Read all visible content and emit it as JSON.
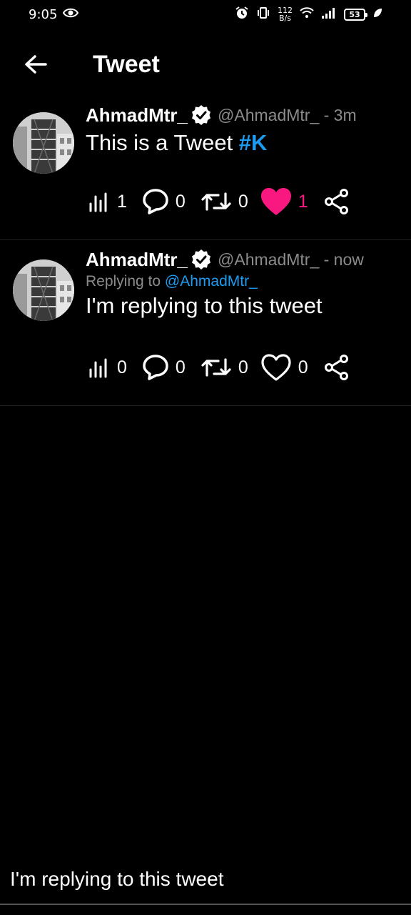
{
  "status_bar": {
    "time": "9:05",
    "net_speed_value": "112",
    "net_speed_unit": "B/s",
    "battery": "53"
  },
  "app_bar": {
    "title": "Tweet"
  },
  "tweets": [
    {
      "display_name": "AhmadMtr_",
      "handle_time": "@AhmadMtr_ - 3m",
      "text_plain": "This is a Tweet ",
      "hashtag": "#K",
      "views": "1",
      "replies": "0",
      "retweets": "0",
      "likes": "1",
      "liked": true
    },
    {
      "display_name": "AhmadMtr_",
      "handle_time": "@AhmadMtr_ - now",
      "replying_prefix": "Replying to ",
      "replying_to": "@AhmadMtr_",
      "text": "I'm replying to this tweet",
      "views": "0",
      "replies": "0",
      "retweets": "0",
      "likes": "0",
      "liked": false
    }
  ],
  "composer": {
    "value": "I'm replying to this tweet"
  },
  "colors": {
    "background": "#000000",
    "accent": "#1d9bf0",
    "like": "#f91880",
    "muted": "#8b8b8b"
  }
}
